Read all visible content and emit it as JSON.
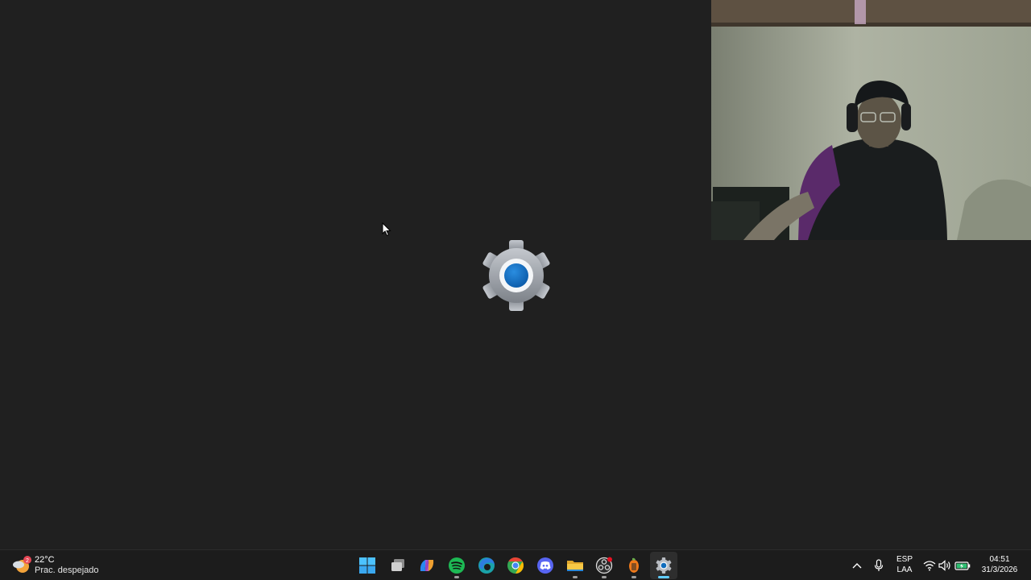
{
  "weather": {
    "temperature": "22°C",
    "condition": "Prac. despejado",
    "badge": "2"
  },
  "splash": {
    "icon": "settings-gear-icon",
    "accent": "#0f6cbd"
  },
  "taskbar": {
    "apps": [
      {
        "name": "start-button",
        "icon": "windows-logo-icon"
      },
      {
        "name": "task-view-button",
        "icon": "task-view-icon"
      },
      {
        "name": "copilot-app",
        "icon": "copilot-icon"
      },
      {
        "name": "spotify-app",
        "icon": "spotify-icon",
        "color": "#1db954"
      },
      {
        "name": "edge-app",
        "icon": "edge-icon"
      },
      {
        "name": "chrome-app",
        "icon": "chrome-icon"
      },
      {
        "name": "discord-app",
        "icon": "discord-icon",
        "color": "#5865f2"
      },
      {
        "name": "file-explorer-app",
        "icon": "folder-icon",
        "color": "#f8c846"
      },
      {
        "name": "obs-app",
        "icon": "obs-icon"
      },
      {
        "name": "fl-studio-app",
        "icon": "fl-studio-icon"
      },
      {
        "name": "settings-app",
        "icon": "settings-gear-icon",
        "active": true
      }
    ],
    "tray": {
      "language": "ESP",
      "layout": "LAA",
      "time": "04:51",
      "date": "31/3/2026"
    }
  },
  "colors": {
    "desktop_bg": "#202020",
    "taskbar_bg": "#1c1c1c",
    "active_indicator": "#60cdff"
  }
}
